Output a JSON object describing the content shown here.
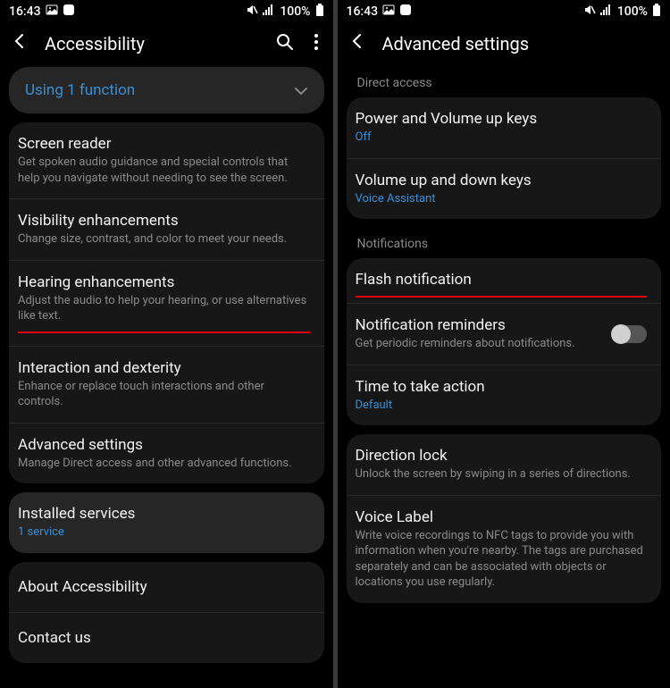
{
  "status": {
    "time": "16:43",
    "battery": "100%"
  },
  "left": {
    "title": "Accessibility",
    "banner": "Using 1 function",
    "items": [
      {
        "title": "Screen reader",
        "sub": "Get spoken audio guidance and special controls that help you navigate without needing to see the screen."
      },
      {
        "title": "Visibility enhancements",
        "sub": "Change size, contrast, and color to meet your needs."
      },
      {
        "title": "Hearing enhancements",
        "sub": "Adjust the audio to help your hearing, or use alternatives like text."
      },
      {
        "title": "Interaction and dexterity",
        "sub": "Enhance or replace touch interactions and other controls."
      },
      {
        "title": "Advanced settings",
        "sub": "Manage Direct access and other advanced functions."
      }
    ],
    "installed": {
      "title": "Installed services",
      "sub": "1 service"
    },
    "about": "About Accessibility",
    "contact": "Contact us"
  },
  "right": {
    "title": "Advanced settings",
    "section1": "Direct access",
    "direct": [
      {
        "title": "Power and Volume up keys",
        "sub": "Off"
      },
      {
        "title": "Volume up and down keys",
        "sub": "Voice Assistant"
      }
    ],
    "section2": "Notifications",
    "flash": "Flash notification",
    "remind": {
      "title": "Notification reminders",
      "sub": "Get periodic reminders about notifications."
    },
    "time": {
      "title": "Time to take action",
      "sub": "Default"
    },
    "dir": {
      "title": "Direction lock",
      "sub": "Unlock the screen by swiping in a series of directions."
    },
    "voice": {
      "title": "Voice Label",
      "sub": "Write voice recordings to NFC tags to provide you with information when you're nearby. The tags are purchased separately and can be associated with objects or locations you use regularly."
    }
  }
}
